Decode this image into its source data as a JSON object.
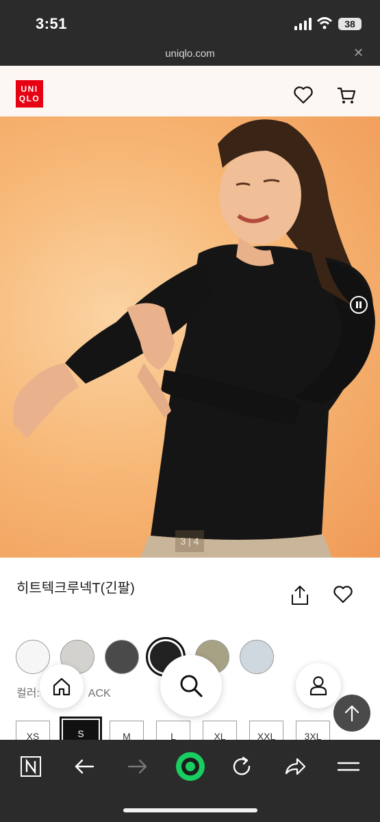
{
  "status_bar": {
    "time": "3:51",
    "battery": "38"
  },
  "browser": {
    "url": "uniqlo.com",
    "close_glyph": "✕"
  },
  "header": {
    "logo_line1": "UNI",
    "logo_line2": "QLO",
    "brand_color": "#e60012"
  },
  "hero": {
    "image_counter": "3 | 4",
    "image_index": 3,
    "image_total": 4
  },
  "product": {
    "title": "히트텍크루넥T(긴팔)",
    "color_label": "컬러: ",
    "color_value": "BLACK",
    "color_label_visible": "컬러:",
    "color_label_tail": "ACK",
    "swatches": [
      "#f6f6f6",
      "#d4d2cf",
      "#4a4a4a",
      "#222222",
      "#a8a285",
      "#cfd8df"
    ],
    "selected_swatch": 3,
    "sizes": [
      "XS",
      "S",
      "M",
      "L",
      "XL",
      "XXL",
      "3XL"
    ],
    "selected_size": "S"
  },
  "icons": {
    "header": [
      "heart-icon",
      "cart-icon"
    ],
    "hero": [
      "pause-icon"
    ],
    "product": [
      "share-icon",
      "heart-icon"
    ],
    "floating": [
      "home-icon",
      "search-icon",
      "user-icon",
      "arrow-up-icon"
    ],
    "toolbar": [
      "naver-n-icon",
      "back-arrow-icon",
      "forward-arrow-icon",
      "green-dot-icon",
      "refresh-icon",
      "share-arrow-icon",
      "menu-icon"
    ]
  },
  "colors": {
    "accent_green": "#19ce60",
    "toolbar_bg": "#2b2b2b"
  }
}
